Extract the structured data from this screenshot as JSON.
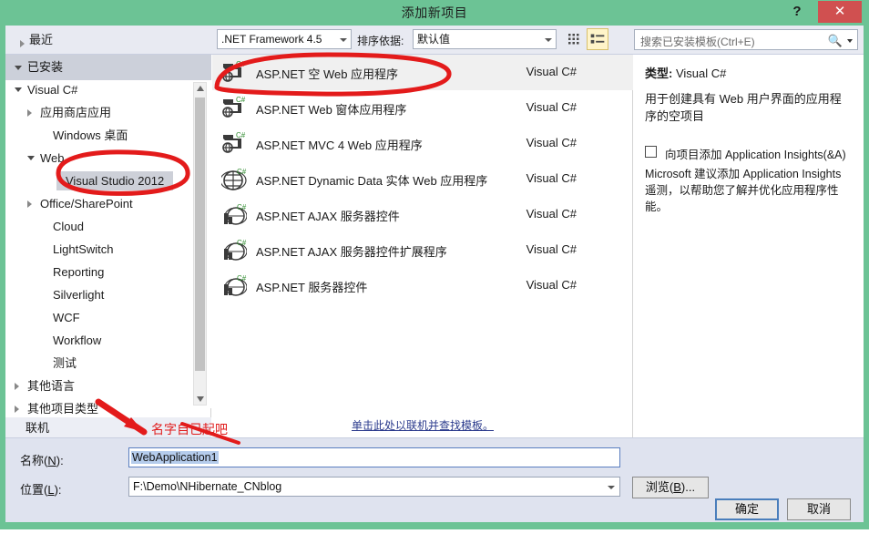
{
  "window": {
    "title": "添加新项目",
    "help_label": "?",
    "close_label": "✕",
    "frame_color": "#6cc395",
    "close_color": "#d05050"
  },
  "toolbar": {
    "recent_label": "最近",
    "framework_value": ".NET Framework 4.5",
    "sortby_label": "排序依据:",
    "sortby_value": "默认值",
    "view_tiles_icon": "tiles-view-icon",
    "view_list_icon": "list-view-icon",
    "search_placeholder": "搜索已安装模板(Ctrl+E)",
    "search_icon": "search-icon"
  },
  "sidebar": {
    "installed_label": "已安装",
    "online_label": "联机",
    "items": [
      {
        "label": "Visual C#",
        "indent": 10,
        "state": "open",
        "selected": false
      },
      {
        "label": "应用商店应用",
        "indent": 24,
        "state": "closed",
        "selected": false
      },
      {
        "label": "Windows 桌面",
        "indent": 38,
        "state": "none",
        "selected": false
      },
      {
        "label": "Web",
        "indent": 24,
        "state": "open",
        "selected": false
      },
      {
        "label": "Visual Studio 2012",
        "indent": 52,
        "state": "none",
        "selected": true
      },
      {
        "label": "Office/SharePoint",
        "indent": 24,
        "state": "closed",
        "selected": false
      },
      {
        "label": "Cloud",
        "indent": 38,
        "state": "none",
        "selected": false
      },
      {
        "label": "LightSwitch",
        "indent": 38,
        "state": "none",
        "selected": false
      },
      {
        "label": "Reporting",
        "indent": 38,
        "state": "none",
        "selected": false
      },
      {
        "label": "Silverlight",
        "indent": 38,
        "state": "none",
        "selected": false
      },
      {
        "label": "WCF",
        "indent": 38,
        "state": "none",
        "selected": false
      },
      {
        "label": "Workflow",
        "indent": 38,
        "state": "none",
        "selected": false
      },
      {
        "label": "测试",
        "indent": 38,
        "state": "none",
        "selected": false
      },
      {
        "label": "其他语言",
        "indent": 10,
        "state": "closed",
        "selected": false
      },
      {
        "label": "其他项目类型",
        "indent": 10,
        "state": "closed",
        "selected": false
      }
    ]
  },
  "templates": {
    "online_link": "单击此处以联机并查找模板。",
    "rows": [
      {
        "name": "ASP.NET 空 Web 应用程序",
        "lang": "Visual C#",
        "icon": "web-app-csharp-icon",
        "selected": true
      },
      {
        "name": "ASP.NET Web 窗体应用程序",
        "lang": "Visual C#",
        "icon": "web-app-csharp-icon",
        "selected": false
      },
      {
        "name": "ASP.NET MVC 4 Web 应用程序",
        "lang": "Visual C#",
        "icon": "web-app-csharp-icon",
        "selected": false
      },
      {
        "name": "ASP.NET Dynamic Data 实体 Web 应用程序",
        "lang": "Visual C#",
        "icon": "web-globe-csharp-icon",
        "selected": false
      },
      {
        "name": "ASP.NET AJAX 服务器控件",
        "lang": "Visual C#",
        "icon": "server-control-icon",
        "selected": false
      },
      {
        "name": "ASP.NET AJAX 服务器控件扩展程序",
        "lang": "Visual C#",
        "icon": "server-control-icon",
        "selected": false
      },
      {
        "name": "ASP.NET 服务器控件",
        "lang": "Visual C#",
        "icon": "server-control-icon",
        "selected": false
      }
    ]
  },
  "description": {
    "type_label": "类型:",
    "type_value": "Visual C#",
    "text": "用于创建具有 Web 用户界面的应用程序的空项目",
    "insights_checkbox_label": "向项目添加 Application Insights(&A)",
    "insights_note": "Microsoft 建议添加 Application Insights 遥测，以帮助您了解并优化应用程序性能。"
  },
  "form": {
    "name_label_prefix": "名称(",
    "name_label_key": "N",
    "name_label_suffix": "):",
    "name_value": "WebApplication1",
    "location_label_prefix": "位置(",
    "location_label_key": "L",
    "location_label_suffix": "):",
    "location_value": "F:\\Demo\\NHibernate_CNblog",
    "browse_label_prefix": "浏览(",
    "browse_label_key": "B",
    "browse_label_suffix": ")...",
    "ok_label": "确定",
    "cancel_label": "取消"
  },
  "annotations": {
    "color": "#e01b1b",
    "name_hint": "名字自己起吧"
  }
}
